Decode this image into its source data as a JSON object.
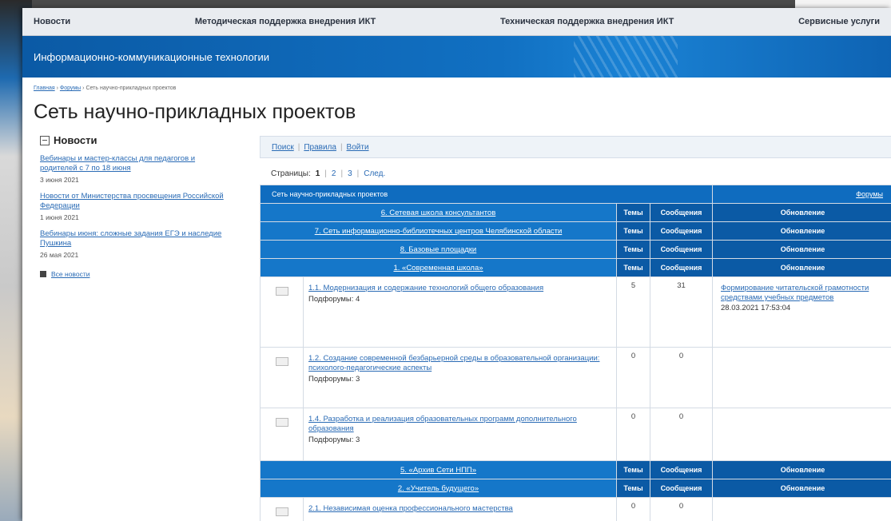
{
  "topnav": [
    "Новости",
    "Методическая поддержка внедрения ИКТ",
    "Техническая поддержка внедрения ИКТ",
    "Сервисные услуги"
  ],
  "banner": {
    "title": "Информационно-коммуникационные технологии"
  },
  "breadcrumb": {
    "home": "Главная",
    "forums": "Форумы",
    "current": "Сеть научно-прикладных проектов",
    "sep": "›"
  },
  "page_title": "Сеть научно-прикладных проектов",
  "news": {
    "heading": "Новости",
    "items": [
      {
        "title": "Вебинары и мастер-классы для педагогов и родителей с 7 по 18 июня",
        "date": "3 июня 2021"
      },
      {
        "title": "Новости от Министерства просвещения Российской Федерации",
        "date": "1 июня 2021"
      },
      {
        "title": "Вебинары июня: сложные задания ЕГЭ и наследие Пушкина",
        "date": "26 мая 2021"
      }
    ],
    "all_link": "Все новости"
  },
  "tools": {
    "search": "Поиск",
    "rules": "Правила",
    "login": "Войти"
  },
  "pager": {
    "label": "Страницы:",
    "current": "1",
    "p2": "2",
    "p3": "3",
    "next": "След."
  },
  "table": {
    "header_title": "Сеть научно-прикладных проектов",
    "header_link": "Форумы",
    "col_topics": "Темы",
    "col_posts": "Сообщения",
    "col_update": "Обновление",
    "categories": [
      "6. Сетевая школа консультантов",
      "7. Сеть информационно-библиотечных центров Челябинской области",
      "8. Базовые площадки",
      "1. «Современная школа»",
      "5. «Архив Сети НПП»",
      "2. «Учитель будущего»"
    ],
    "rows": [
      {
        "title": "1.1. Модернизация и содержание технологий общего образования",
        "sub": "Подфорумы: 4",
        "topics": "5",
        "posts": "31",
        "last_title": "Формирование читательской грамотности средствами учебных предметов",
        "last_date": "28.03.2021 17:53:04"
      },
      {
        "title": "1.2. Создание современной безбарьерной среды в образовательной организации: психолого-педагогические аспекты",
        "sub": "Подфорумы: 3",
        "topics": "0",
        "posts": "0"
      },
      {
        "title": "1.4. Разработка и реализация образовательных программ дополнительного образования",
        "sub": "Подфорумы: 3",
        "topics": "0",
        "posts": "0"
      },
      {
        "title": "2.1. Независимая оценка профессионального мастерства",
        "topics": "0",
        "posts": "0"
      }
    ]
  }
}
